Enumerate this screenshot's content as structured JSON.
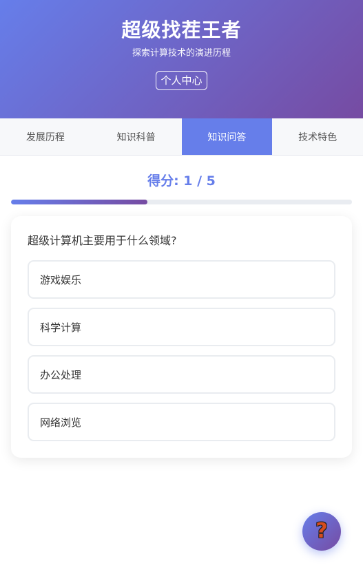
{
  "header": {
    "title": "超级找茬王者",
    "subtitle": "探索计算技术的演进历程",
    "profile_label": "个人中心"
  },
  "tabs": [
    {
      "label": "发展历程",
      "active": false
    },
    {
      "label": "知识科普",
      "active": false
    },
    {
      "label": "知识问答",
      "active": true
    },
    {
      "label": "技术特色",
      "active": false
    }
  ],
  "quiz": {
    "score_text": "得分: 1 / 5",
    "progress_fraction": 0.4,
    "question": "超级计算机主要用于什么领域?",
    "options": [
      "游戏娱乐",
      "科学计算",
      "办公处理",
      "网络浏览"
    ]
  },
  "help_button": {
    "icon": "question-mark-icon",
    "glyph": "?"
  },
  "colors": {
    "accent": "#667eea",
    "accent_end": "#764ba2"
  }
}
